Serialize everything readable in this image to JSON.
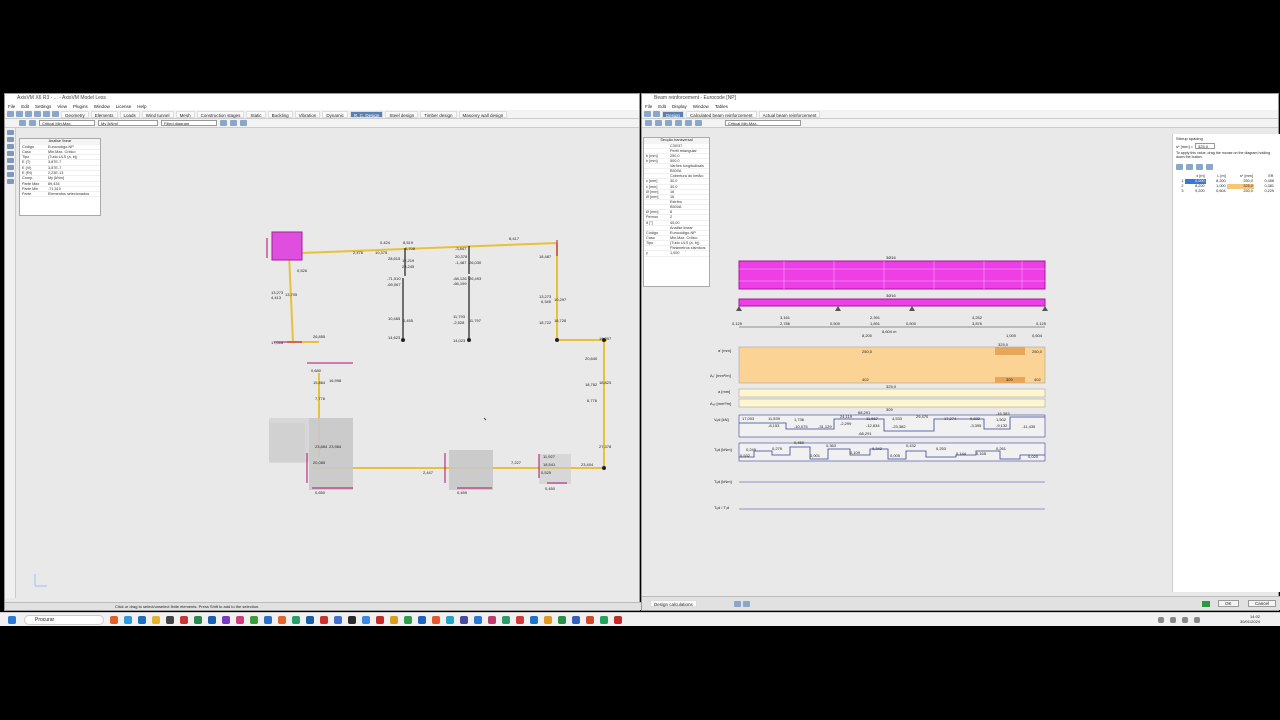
{
  "left_window": {
    "title": "AxisVM X6 R3 - ... - AxisVM Model Less",
    "menu": [
      "File",
      "Edit",
      "Settings",
      "View",
      "Plugins",
      "Window",
      "License",
      "Help"
    ],
    "tabs": [
      "Geometry",
      "Elements",
      "Loads",
      "Wind tunnel",
      "Mesh",
      "Construction stages",
      "Static",
      "Buckling",
      "Vibration",
      "Dynamic",
      "R. C. Design",
      "Steel design",
      "Timber design",
      "Masonry wall design"
    ],
    "active_tab": "R. C. Design",
    "combos": {
      "case": "Critical Min,Max.",
      "component": "My [kNm]",
      "display": "Filled diagram"
    },
    "property_panel": {
      "header": "Analise linear",
      "rows": [
        {
          "k": "Código",
          "v": "Eurocódigo-NP"
        },
        {
          "k": "Caso",
          "v": "Min,Max. Crítico"
        },
        {
          "k": "Tipo",
          "v": "(Tudo ULS (a, b))"
        },
        {
          "k": "E (T)",
          "v": "3,87E-7"
        },
        {
          "k": "E (Vi)",
          "v": "3,87E-7"
        },
        {
          "k": "E (Rt)",
          "v": "2,23E-13"
        },
        {
          "k": "Comp.",
          "v": "My [kNm]"
        },
        {
          "k": "Parte Max",
          "v": "89,434"
        },
        {
          "k": "Parte Min",
          "v": "-71,510"
        },
        {
          "k": "Parte",
          "v": "Elementos selecionados"
        }
      ]
    },
    "status": "Click or drag to select/unselect finite elements. Press Shift to add to the selection.",
    "labels": [
      "13,273",
      "4,413",
      "13,705",
      "17,016",
      "26,855",
      "15,864",
      "7,776",
      "16,998",
      "23,884",
      "20,065",
      "23,984",
      "0,650",
      "0,526",
      "0,680",
      "2,476",
      "10,375",
      "0,424",
      "8,519",
      "0,708",
      "28,615",
      "12,219",
      "23,245",
      "-71,510",
      "-69,067",
      "10,465",
      "0,455",
      "14,623",
      "-3,847",
      "20,378",
      "-1,487",
      "26,030",
      "-68,126",
      "26,493",
      "-66,199",
      "11,793",
      "-2,528",
      "11,797",
      "14,023",
      "8,417",
      "18,487",
      "13,273",
      "6,345",
      "10,297",
      "18,722",
      "16,728",
      "20,640",
      "18,762",
      "18,823",
      "6,776",
      "27,378",
      "23,404",
      "19,297",
      "2,447",
      "7,227",
      "18,541",
      "0,525",
      "11,927",
      "0,450",
      "0,459"
    ]
  },
  "right_window": {
    "title": "Beam reinforcement - Eurocode [NP]",
    "menu": [
      "File",
      "Edit",
      "Display",
      "Window",
      "Tables"
    ],
    "tabs": [
      "Design",
      "Calculated beam reinforcement",
      "Actual beam reinforcement"
    ],
    "combo": "Critical Min,Max.",
    "section_panel": {
      "header": "Secção transversal",
      "rows": [
        {
          "k": "",
          "v": "C30/37"
        },
        {
          "k": "",
          "v": "Perfil retangular"
        },
        {
          "k": "b [mm]",
          "v": "250,0"
        },
        {
          "k": "h [mm]",
          "v": "500,0"
        },
        {
          "k": "",
          "v": "Varões longitudinais"
        },
        {
          "k": "",
          "v": "B500A"
        },
        {
          "k": "",
          "v": "Cobertura do betão:"
        },
        {
          "k": "c [mm]",
          "v": "30,0"
        },
        {
          "k": "c [mm]",
          "v": "30,0"
        },
        {
          "k": "Ø [mm]",
          "v": "16"
        },
        {
          "k": "Ø [mm]",
          "v": "16"
        },
        {
          "k": "",
          "v": "Estribo"
        },
        {
          "k": "",
          "v": "B500A"
        },
        {
          "k": "Ø [mm]",
          "v": "8"
        },
        {
          "k": "Pernos",
          "v": "2"
        },
        {
          "k": "θ [°]",
          "v": "45,00"
        },
        {
          "k": "",
          "v": "Analise linear"
        },
        {
          "k": "Código",
          "v": "Eurocódigo-NP"
        },
        {
          "k": "Caso",
          "v": "Min,Max. Crítico"
        },
        {
          "k": "Tipo",
          "v": "(Tudo ULS (a, b))"
        },
        {
          "k": "",
          "v": "Parâmetros sísmicos"
        },
        {
          "k": "γ",
          "v": "1,000"
        }
      ]
    },
    "diagram": {
      "top_labels": [
        "3Ø16",
        "3Ø16"
      ],
      "dims": [
        "0,125",
        "3,161",
        "2,786",
        "0,500",
        "2,391",
        "1,891",
        "0,500",
        "4,252",
        "3,876",
        "0,125"
      ],
      "span_total": "8,604 m",
      "rows": [
        "a' [mm]",
        "Aₛ' [mm²/m]",
        "a [mm]",
        "Aₛᵥ [mm²/m]",
        "Vₑd [kN]",
        "Tₑd [kNm]",
        "Tₑd [kNm]",
        "Tₑd / Tᵣd"
      ],
      "values": [
        "8,200",
        "1,000",
        "0,604",
        "250,0",
        "325,0",
        "250,0",
        "402",
        "309",
        "402",
        "325,0",
        "309",
        "17,003",
        "11,539",
        "1,736",
        "24,119",
        "11,567",
        "4,533",
        "29,470",
        "17,274",
        "9,832",
        "1,502",
        "-16,383",
        "-8,153",
        "-10,075",
        "-31,129",
        "-2,299",
        "-12,834",
        "-23,382",
        "-3,395",
        "-9,132",
        "-11,439",
        "68,291",
        "-68,291",
        "0,249",
        "0,279",
        "0,450",
        "0,363",
        "0,432",
        "0,253",
        "0,144",
        "0,165",
        "0,261",
        "0,532",
        "0,001",
        "0,109",
        "0,342",
        "0,005",
        "0,020"
      ]
    },
    "stirrup_panel": {
      "title": "Stirrup spacing",
      "field_label": "s* [mm] =",
      "field_value": "325,0",
      "hint": "To apply this value, drag the mouse on the diagram holding down the button.",
      "columns": [
        "",
        "x [m]",
        "L [m]",
        "s* [mm]",
        "Eff."
      ],
      "rows": [
        [
          "1",
          "0,000",
          "8,200",
          "250,0",
          "0,456"
        ],
        [
          "2",
          "8,200",
          "1,000",
          "325,0",
          "0,381"
        ],
        [
          "3",
          "9,200",
          "0,604",
          "250,0",
          "0,229"
        ]
      ]
    },
    "status_tab": "Design calculations",
    "ok": "OK",
    "cancel": "Cancel"
  },
  "taskbar": {
    "search": "Procurar",
    "time": "14:02",
    "date": "30/01/2024"
  }
}
